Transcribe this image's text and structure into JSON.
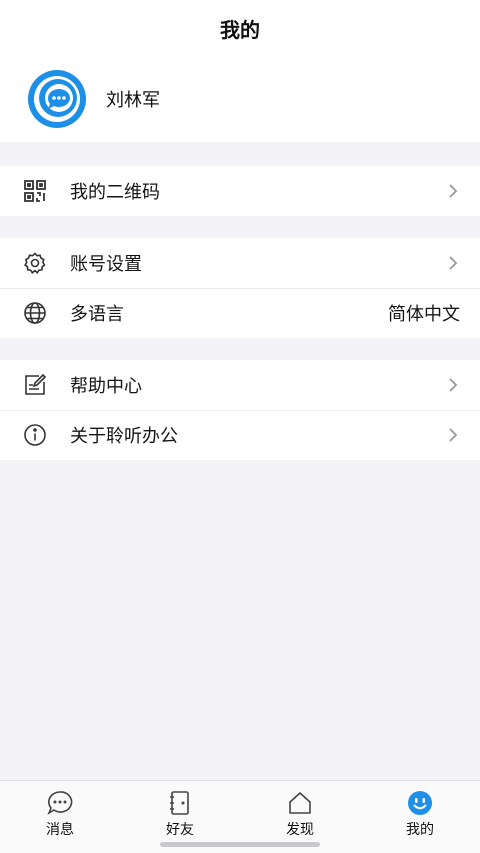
{
  "header": {
    "title": "我的"
  },
  "profile": {
    "name": "刘林军"
  },
  "groups": [
    {
      "items": [
        {
          "label": "我的二维码",
          "icon": "qr-code-icon"
        }
      ]
    },
    {
      "items": [
        {
          "label": "账号设置",
          "icon": "gear-icon"
        },
        {
          "label": "多语言",
          "icon": "globe-icon",
          "value": "简体中文"
        }
      ]
    },
    {
      "items": [
        {
          "label": "帮助中心",
          "icon": "feedback-icon"
        },
        {
          "label": "关于聆听办公",
          "icon": "info-icon"
        }
      ]
    }
  ],
  "tabbar": {
    "tabs": [
      {
        "label": "消息",
        "icon": "chat-icon"
      },
      {
        "label": "好友",
        "icon": "contacts-icon"
      },
      {
        "label": "发现",
        "icon": "discover-icon"
      },
      {
        "label": "我的",
        "icon": "smile-icon"
      }
    ],
    "active_index": 3
  },
  "colors": {
    "accent": "#1e90e8",
    "background": "#f3f3f8"
  }
}
